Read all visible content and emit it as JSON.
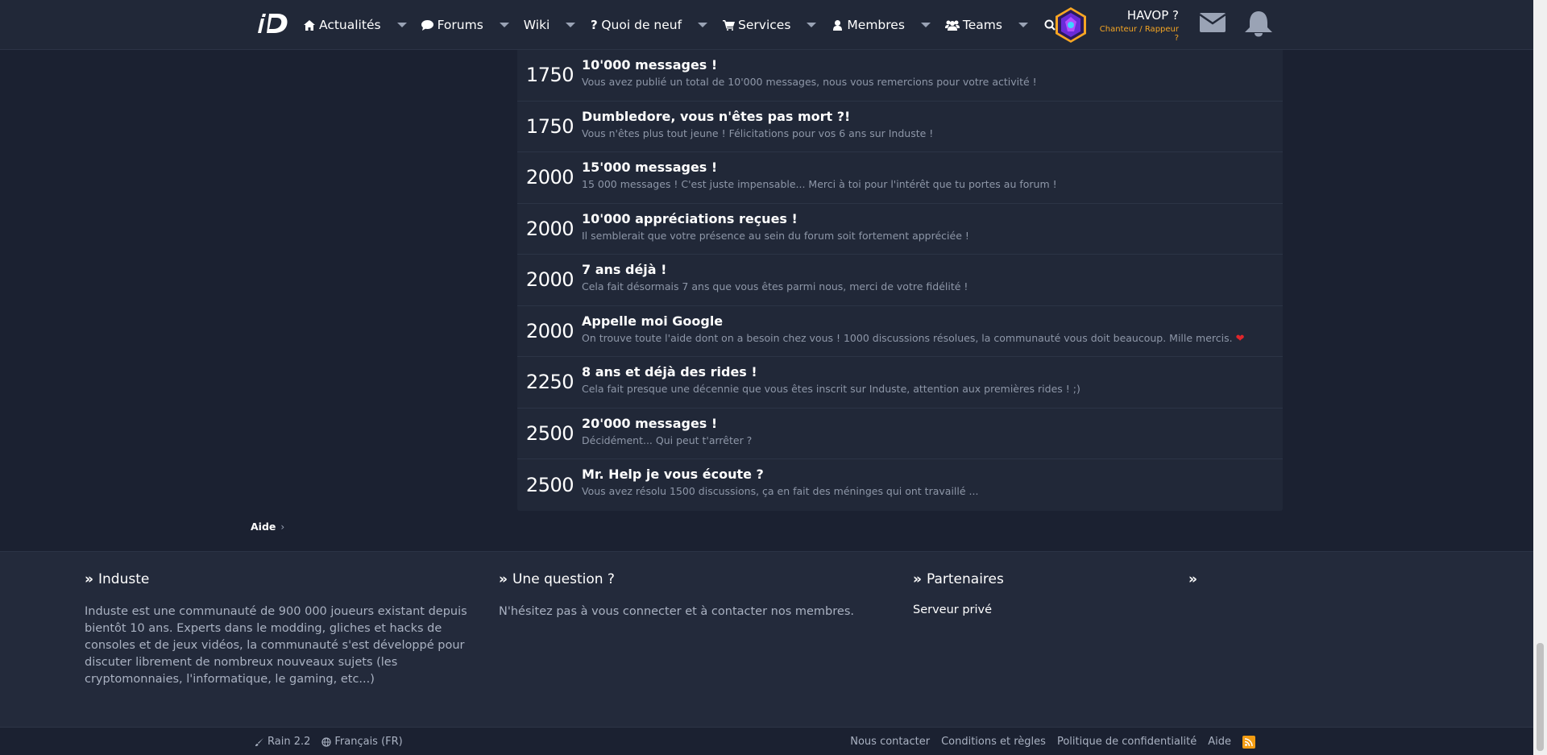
{
  "nav": {
    "items": [
      {
        "label": "Actualités",
        "icon": "home-icon"
      },
      {
        "label": "Forums",
        "icon": "comment-icon"
      },
      {
        "label": "Wiki",
        "icon": ""
      },
      {
        "label": "Quoi de neuf",
        "icon": "question-icon"
      },
      {
        "label": "Services",
        "icon": "cart-icon"
      },
      {
        "label": "Membres",
        "icon": "user-icon"
      },
      {
        "label": "Teams",
        "icon": "users-icon"
      }
    ],
    "username": "HAVOP ?",
    "user_title": "Chanteur / Rappeur ?"
  },
  "trophies": [
    {
      "points": "1750",
      "title": "10'000 messages !",
      "desc": "Vous avez publié un total de 10'000 messages, nous vous remercions pour votre activité !"
    },
    {
      "points": "1750",
      "title": "Dumbledore, vous n'êtes pas mort ?!",
      "desc": "Vous n'êtes plus tout jeune ! Félicitations pour vos 6 ans sur Induste !"
    },
    {
      "points": "2000",
      "title": "15'000 messages !",
      "desc": "15 000 messages ! C'est juste impensable... Merci à toi pour l'intérêt que tu portes au forum !"
    },
    {
      "points": "2000",
      "title": "10'000 appréciations reçues !",
      "desc": "Il semblerait que votre présence au sein du forum soit fortement appréciée !"
    },
    {
      "points": "2000",
      "title": "7 ans déjà !",
      "desc": "Cela fait désormais 7 ans que vous êtes parmi nous, merci de votre fidélité !"
    },
    {
      "points": "2000",
      "title": "Appelle moi Google",
      "desc": "On trouve toute l'aide dont on a besoin chez vous ! 1000 discussions résolues, la communauté vous doit beaucoup. Mille mercis."
    },
    {
      "points": "2250",
      "title": "8 ans et déjà des rides !",
      "desc": "Cela fait presque une décennie que vous êtes inscrit sur Induste, attention aux premières rides ! ;)"
    },
    {
      "points": "2500",
      "title": "20'000 messages !",
      "desc": "Décidément... Qui peut t'arrêter ?"
    },
    {
      "points": "2500",
      "title": "Mr. Help je vous écoute ?",
      "desc": "Vous avez résolu 1500 discussions, ça en fait des méninges qui ont travaillé ..."
    }
  ],
  "breadcrumb": {
    "label": "Aide"
  },
  "footer": {
    "col1": {
      "title": "Induste",
      "text": "Induste est une communauté de 900 000 joueurs existant depuis bientôt 10 ans. Experts dans le modding, gliches et hacks de consoles et de jeux vidéos, la communauté s'est développé pour discuter librement de nombreux nouveaux sujets (les cryptomonnaies, l'informatique, le gaming, etc...)"
    },
    "col2": {
      "title": "Une question ?",
      "text": "N'hésitez pas à vous connecter et à contacter nos membres."
    },
    "col3": {
      "title": "Partenaires",
      "link": "Serveur privé"
    },
    "col4": {
      "title": ""
    }
  },
  "bottombar": {
    "style": "Rain 2.2",
    "language": "Français (FR)",
    "links": [
      "Nous contacter",
      "Conditions et règles",
      "Politique de confidentialité",
      "Aide"
    ]
  },
  "colors": {
    "accent": "#f6a623",
    "background": "#1b2131",
    "panel": "#212838",
    "rss": "#f39c12",
    "heart": "#e0262b"
  }
}
